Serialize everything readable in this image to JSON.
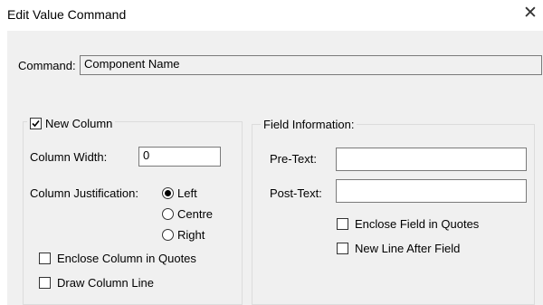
{
  "window": {
    "title": "Edit Value Command",
    "close_glyph": "✕"
  },
  "command": {
    "label": "Command:",
    "value": "Component Name"
  },
  "new_column": {
    "label": "New Column",
    "checked": true,
    "column_width_label": "Column Width:",
    "column_width_value": "0",
    "justification_label": "Column Justification:",
    "justification_options": [
      "Left",
      "Centre",
      "Right"
    ],
    "justification_selected": "Left",
    "enclose_label": "Enclose Column in Quotes",
    "enclose_checked": false,
    "draw_line_label": "Draw Column Line",
    "draw_line_checked": false
  },
  "field_info": {
    "legend": "Field Information:",
    "pre_text_label": "Pre-Text:",
    "pre_text_value": "",
    "post_text_label": "Post-Text:",
    "post_text_value": "",
    "enclose_label": "Enclose Field in Quotes",
    "enclose_checked": false,
    "new_line_label": "New Line After Field",
    "new_line_checked": false
  }
}
